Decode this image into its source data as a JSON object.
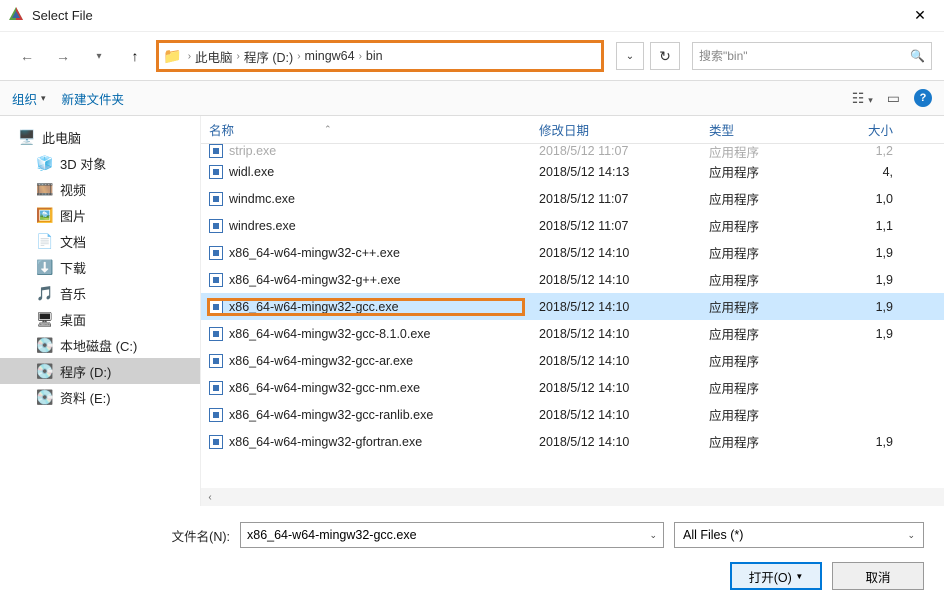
{
  "window": {
    "title": "Select File"
  },
  "breadcrumb": {
    "root": "此电脑",
    "drive": "程序 (D:)",
    "folder1": "mingw64",
    "folder2": "bin"
  },
  "search": {
    "placeholder": "搜索\"bin\""
  },
  "toolbar": {
    "organize": "组织",
    "newfolder": "新建文件夹"
  },
  "sidebar": {
    "items": [
      {
        "label": "此电脑",
        "icon": "🖥️"
      },
      {
        "label": "3D 对象",
        "icon": "🧊"
      },
      {
        "label": "视频",
        "icon": "🎞️"
      },
      {
        "label": "图片",
        "icon": "🖼️"
      },
      {
        "label": "文档",
        "icon": "📄"
      },
      {
        "label": "下载",
        "icon": "⬇️"
      },
      {
        "label": "音乐",
        "icon": "🎵"
      },
      {
        "label": "桌面",
        "icon": "🖥"
      },
      {
        "label": "本地磁盘 (C:)",
        "icon": "💽"
      },
      {
        "label": "程序 (D:)",
        "icon": "💽"
      },
      {
        "label": "资料 (E:)",
        "icon": "💽"
      }
    ]
  },
  "columns": {
    "name": "名称",
    "date": "修改日期",
    "type": "类型",
    "size": "大小"
  },
  "files": {
    "cutoff": {
      "name": "strip.exe",
      "date": "2018/5/12 11:07",
      "type": "应用程序",
      "size": "1,2"
    },
    "rows": [
      {
        "name": "widl.exe",
        "date": "2018/5/12 14:13",
        "type": "应用程序",
        "size": "4,"
      },
      {
        "name": "windmc.exe",
        "date": "2018/5/12 11:07",
        "type": "应用程序",
        "size": "1,0"
      },
      {
        "name": "windres.exe",
        "date": "2018/5/12 11:07",
        "type": "应用程序",
        "size": "1,1"
      },
      {
        "name": "x86_64-w64-mingw32-c++.exe",
        "date": "2018/5/12 14:10",
        "type": "应用程序",
        "size": "1,9"
      },
      {
        "name": "x86_64-w64-mingw32-g++.exe",
        "date": "2018/5/12 14:10",
        "type": "应用程序",
        "size": "1,9"
      },
      {
        "name": "x86_64-w64-mingw32-gcc.exe",
        "date": "2018/5/12 14:10",
        "type": "应用程序",
        "size": "1,9"
      },
      {
        "name": "x86_64-w64-mingw32-gcc-8.1.0.exe",
        "date": "2018/5/12 14:10",
        "type": "应用程序",
        "size": "1,9"
      },
      {
        "name": "x86_64-w64-mingw32-gcc-ar.exe",
        "date": "2018/5/12 14:10",
        "type": "应用程序",
        "size": ""
      },
      {
        "name": "x86_64-w64-mingw32-gcc-nm.exe",
        "date": "2018/5/12 14:10",
        "type": "应用程序",
        "size": ""
      },
      {
        "name": "x86_64-w64-mingw32-gcc-ranlib.exe",
        "date": "2018/5/12 14:10",
        "type": "应用程序",
        "size": ""
      },
      {
        "name": "x86_64-w64-mingw32-gfortran.exe",
        "date": "2018/5/12 14:10",
        "type": "应用程序",
        "size": "1,9"
      }
    ],
    "selected_index": 5
  },
  "bottom": {
    "filename_label": "文件名(N):",
    "filename_value": "x86_64-w64-mingw32-gcc.exe",
    "filter": "All Files  (*)",
    "open": "打开(O)",
    "cancel": "取消"
  }
}
